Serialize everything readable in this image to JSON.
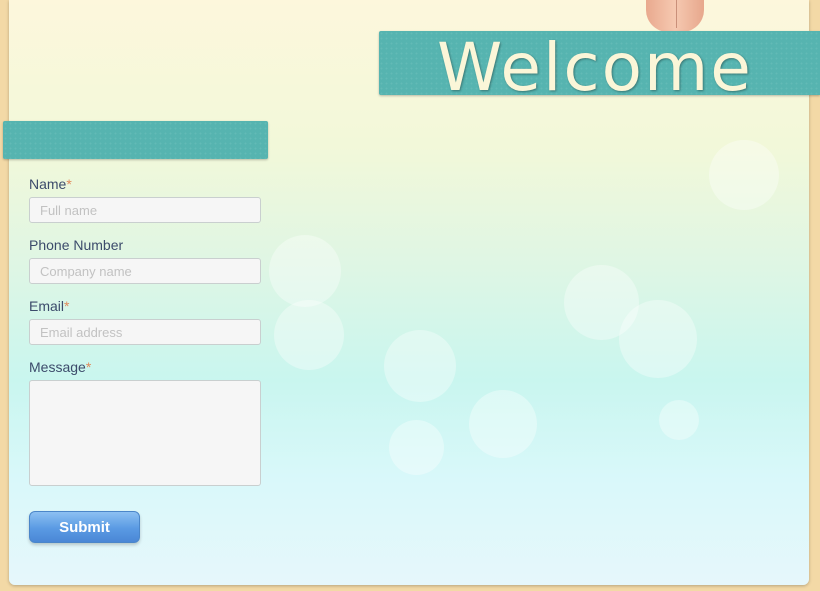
{
  "header": {
    "title": "Welcome"
  },
  "form": {
    "fields": [
      {
        "label": "Name",
        "required": true,
        "placeholder": "Full name"
      },
      {
        "label": "Phone Number",
        "required": false,
        "placeholder": "Company name"
      },
      {
        "label": "Email",
        "required": true,
        "placeholder": "Email address"
      },
      {
        "label": "Message",
        "required": true,
        "placeholder": ""
      }
    ],
    "required_mark": "*",
    "submit_label": "Submit"
  },
  "colors": {
    "banner": "#56b4b0",
    "title_text": "#fbf6d8",
    "label_text": "#3c4b6b",
    "required_mark": "#e08a5c",
    "submit_button": "#5a9ae3"
  }
}
